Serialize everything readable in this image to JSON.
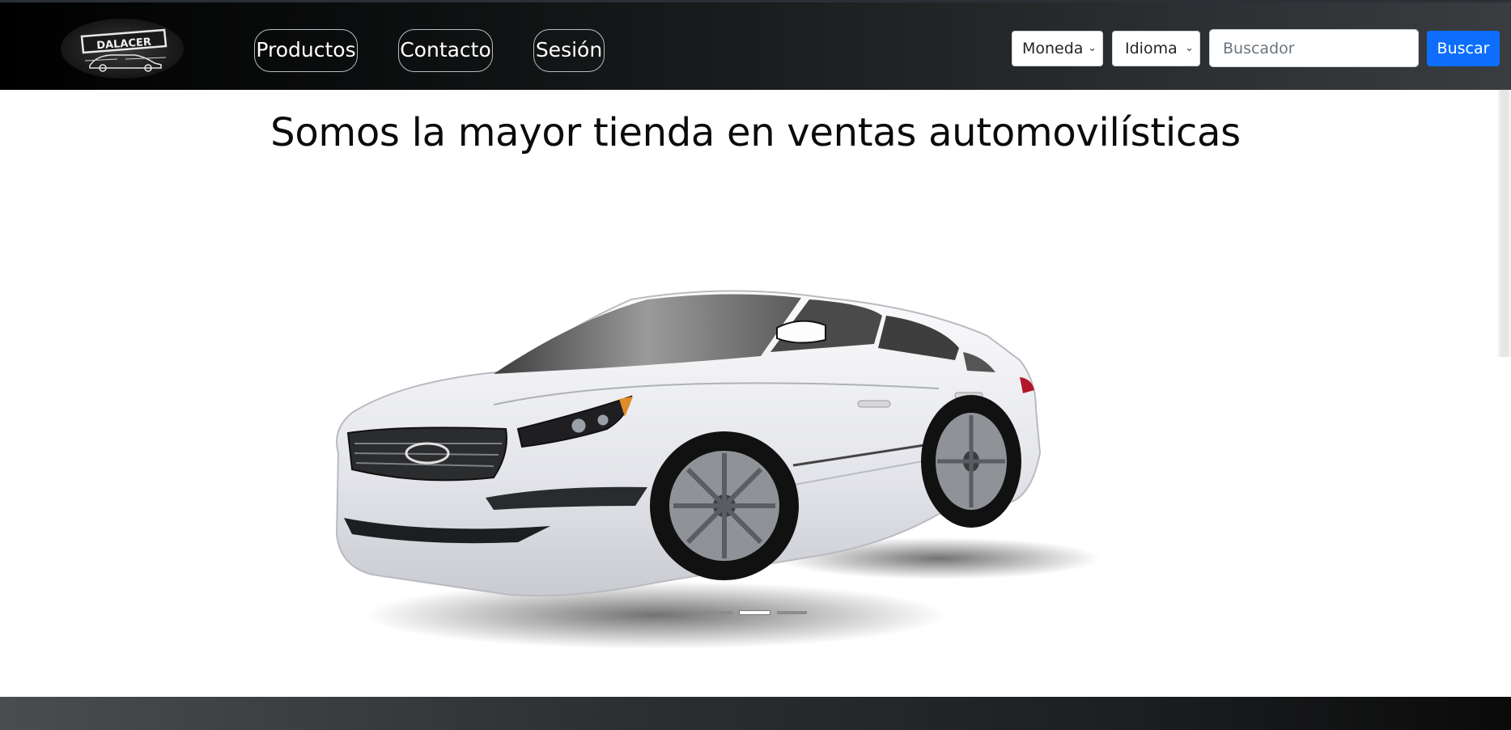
{
  "brand": {
    "logo_text": "DALACER",
    "logo_icon": "car-logo-icon"
  },
  "nav": {
    "items": [
      {
        "label": "Productos"
      },
      {
        "label": "Contacto"
      },
      {
        "label": "Sesión"
      }
    ]
  },
  "controls": {
    "currency_select": {
      "value": "Moneda",
      "icon": "chevron-down-icon"
    },
    "language_select": {
      "value": "Idioma",
      "icon": "chevron-down-icon"
    },
    "search": {
      "placeholder": "Buscador",
      "value": ""
    },
    "search_button": "Buscar"
  },
  "main": {
    "headline": "Somos la mayor tienda en ventas automovilísticas",
    "carousel": {
      "slide_image": "white-sedan-car",
      "indicators": 3,
      "active_index": 1
    }
  },
  "colors": {
    "navbar_dark": "#000000",
    "navbar_light": "#3a3d40",
    "primary_button": "#0d6efd"
  }
}
